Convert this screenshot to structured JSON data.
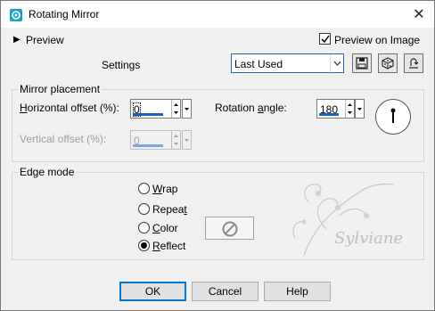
{
  "window": {
    "title": "Rotating Mirror"
  },
  "preview": {
    "label": "Preview",
    "checkbox_label": "Preview on Image",
    "checked": true
  },
  "settings": {
    "label": "Settings",
    "preset_value": "Last Used"
  },
  "mirror_placement": {
    "title": "Mirror placement",
    "horizontal_offset_label_pre": "",
    "horizontal_offset_label_ul": "H",
    "horizontal_offset_label_post": "orizontal offset (%):",
    "horizontal_offset_value": "0",
    "vertical_offset_label": "Vertical offset (%):",
    "vertical_offset_value": "0",
    "rotation_label_pre": "Rotation ",
    "rotation_label_ul": "a",
    "rotation_label_post": "ngle:",
    "rotation_value": "180"
  },
  "edge_mode": {
    "title": "Edge mode",
    "options": [
      {
        "pre": "",
        "ul": "W",
        "post": "rap",
        "checked": false
      },
      {
        "pre": "Repea",
        "ul": "t",
        "post": "",
        "checked": false
      },
      {
        "pre": "",
        "ul": "C",
        "post": "olor",
        "checked": false
      },
      {
        "pre": "",
        "ul": "R",
        "post": "eflect",
        "checked": true
      }
    ]
  },
  "watermark": {
    "text": "Sylviane"
  },
  "buttons": {
    "ok": "OK",
    "cancel": "Cancel",
    "help": "Help"
  },
  "colors": {
    "accent": "#0078d7",
    "bar": "#1f5fbf",
    "window_bg": "#f0f0f0"
  }
}
